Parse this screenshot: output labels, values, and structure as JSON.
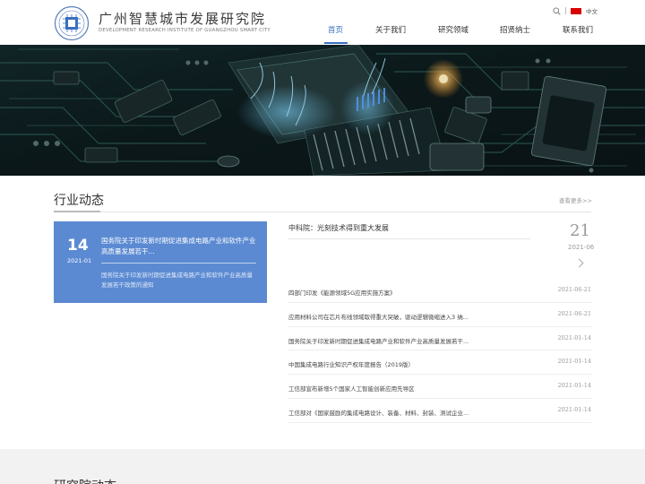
{
  "header": {
    "logo_cn": "广州智慧城市发展研究院",
    "logo_en": "DEVELOPMENT RESEARCH INSTITUTE OF GUANGZHOU SMART CITY",
    "language": "中文",
    "nav": [
      "首页",
      "关于我们",
      "研究领域",
      "招贤纳士",
      "联系我们"
    ],
    "active_nav": "首页",
    "accent_color": "#3a6fc0"
  },
  "banner": {
    "slides": 3,
    "active_slide": 1
  },
  "industry_news": {
    "title": "行业动态",
    "more": "查看更多>>",
    "featured": {
      "day": "14",
      "year_month": "2021-01",
      "title": "国务院关于印发新时期促进集成电路产业和软件产业高质量发展若干...",
      "desc": "国务院关于印发新时期促进集成电路产业和软件产业高质量发展若干政策的通知",
      "color": "#5b8ad2"
    },
    "top_item": {
      "title": "中科院：光刻技术得到重大发展",
      "day": "21",
      "year_month": "2021-06"
    },
    "items": [
      {
        "title": "四部门印发《能源领域5G应用实施方案》",
        "date": "2021-06-21"
      },
      {
        "title": "应用材料公司在芯片布线领域取得重大突破，驱动逻辑微缩进入3 纳...",
        "date": "2021-06-21"
      },
      {
        "title": "国务院关于印发新时期促进集成电路产业和软件产业高质量发展若干...",
        "date": "2021-01-14"
      },
      {
        "title": "中国集成电路行业知识产权年度报告（2019版）",
        "date": "2021-01-14"
      },
      {
        "title": "工信部宣布新增5个国家人工智能创新应用先导区",
        "date": "2021-01-14"
      },
      {
        "title": "工信部对《国家鼓励的集成电路设计、装备、材料、封装、测试企业...",
        "date": "2021-01-14"
      }
    ]
  },
  "institute_news": {
    "title": "研究院动态"
  }
}
